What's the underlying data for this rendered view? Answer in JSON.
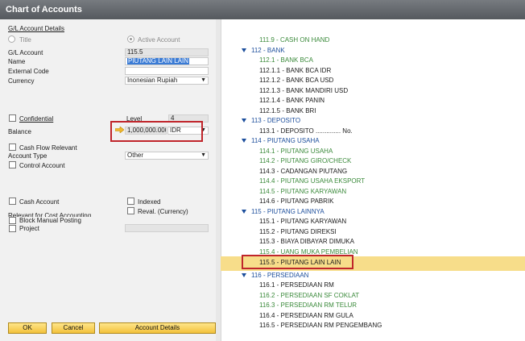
{
  "window": {
    "title": "Chart of Accounts"
  },
  "details": {
    "section_link": "G/L Account Details",
    "title_radio": "Title",
    "active_radio": "Active Account",
    "gl_account_label": "G/L Account",
    "gl_account_value": "115.5",
    "name_label": "Name",
    "name_value": "PIUTANG LAIN LAIN",
    "external_code_label": "External Code",
    "external_code_value": "",
    "currency_label": "Currency",
    "currency_value": "Inonesian Rupiah",
    "confidential_label": "Confidential",
    "level_label": "Level",
    "level_value": "4",
    "balance_label": "Balance",
    "balance_value": "1,000,000.000",
    "balance_currency": "IDR",
    "cash_flow_label": "Cash Flow Relevant",
    "account_type_label": "Account Type",
    "account_type_value": "Other",
    "control_account_label": "Control Account",
    "cash_account_label": "Cash Account",
    "indexed_label": "Indexed",
    "reval_label": "Reval. (Currency)",
    "relevant_cost_label": "Relevant for Cost Accounting",
    "block_manual_label": "Block Manual Posting",
    "project_label": "Project",
    "project_value": ""
  },
  "buttons": {
    "ok": "OK",
    "cancel": "Cancel",
    "account_details": "Account Details"
  },
  "tree": [
    {
      "text": "111.9 - CASH ON HAND",
      "kind": "green",
      "level": 2
    },
    {
      "text": "112 - BANK",
      "kind": "blue",
      "level": 1
    },
    {
      "text": "112.1 - BANK BCA",
      "kind": "green",
      "level": 2
    },
    {
      "text": "112.1.1 - BANK BCA IDR",
      "kind": "black",
      "level": 2
    },
    {
      "text": "112.1.2 - BANK BCA USD",
      "kind": "black",
      "level": 2
    },
    {
      "text": "112.1.3 - BANK MANDIRI USD",
      "kind": "black",
      "level": 2
    },
    {
      "text": "112.1.4 - BANK PANIN",
      "kind": "black",
      "level": 2
    },
    {
      "text": "112.1.5 - BANK BRI",
      "kind": "black",
      "level": 2
    },
    {
      "text": "113 - DEPOSITO",
      "kind": "blue",
      "level": 1
    },
    {
      "text": "113.1 - DEPOSITO .............. No.",
      "kind": "black",
      "level": 2
    },
    {
      "text": "114 - PIUTANG USAHA",
      "kind": "blue",
      "level": 1
    },
    {
      "text": "114.1 - PIUTANG USAHA",
      "kind": "green",
      "level": 2
    },
    {
      "text": "114.2 - PIUTANG GIRO/CHECK",
      "kind": "green",
      "level": 2
    },
    {
      "text": "114.3 - CADANGAN PIUTANG",
      "kind": "black",
      "level": 2
    },
    {
      "text": "114.4 - PIUTANG USAHA EKSPORT",
      "kind": "green",
      "level": 2
    },
    {
      "text": "114.5 - PIUTANG KARYAWAN",
      "kind": "green",
      "level": 2
    },
    {
      "text": "114.6 - PIUTANG PABRIK",
      "kind": "black",
      "level": 2
    },
    {
      "text": "115 - PIUTANG LAINNYA",
      "kind": "blue",
      "level": 1
    },
    {
      "text": "115.1 - PIUTANG KARYAWAN",
      "kind": "black",
      "level": 2
    },
    {
      "text": "115.2 - PIUTANG DIREKSI",
      "kind": "black",
      "level": 2
    },
    {
      "text": "115.3 - BIAYA DIBAYAR DIMUKA",
      "kind": "black",
      "level": 2
    },
    {
      "text": "115.4 - UANG MUKA PEMBELIAN",
      "kind": "green",
      "level": 2
    },
    {
      "text": "115.5 - PIUTANG LAIN LAIN",
      "kind": "black",
      "level": 2
    },
    {
      "text": "116 - PERSEDIAAN",
      "kind": "blue",
      "level": 1
    },
    {
      "text": "116.1 - PERSEDIAAN RM",
      "kind": "black",
      "level": 2
    },
    {
      "text": "116.2 - PERSEDIAAN SF COKLAT",
      "kind": "green",
      "level": 2
    },
    {
      "text": "116.3 - PERSEDIAAN RM TELUR",
      "kind": "green",
      "level": 2
    },
    {
      "text": "116.4 - PERSEDIAAN RM GULA",
      "kind": "black",
      "level": 2
    },
    {
      "text": "116.5 - PERSEDIAAN RM PENGEMBANG",
      "kind": "black",
      "level": 2
    }
  ],
  "selected_tree_index": 22
}
